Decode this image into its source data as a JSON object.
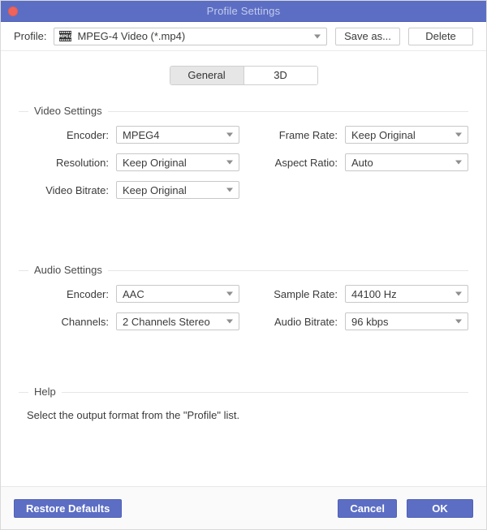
{
  "titlebar": {
    "title": "Profile Settings",
    "close_label": "close",
    "bg_color": "#5c6ec4",
    "close_color": "#f1635a"
  },
  "profile_row": {
    "label": "Profile:",
    "icon": "mpeg-film-icon",
    "value": "MPEG-4 Video (*.mp4)",
    "save_as_label": "Save as...",
    "delete_label": "Delete"
  },
  "tabs": [
    {
      "label": "General",
      "active": true
    },
    {
      "label": "3D",
      "active": false
    }
  ],
  "video_settings": {
    "title": "Video Settings",
    "fields": [
      {
        "label": "Encoder:",
        "value": "MPEG4"
      },
      {
        "label": "Frame Rate:",
        "value": "Keep Original"
      },
      {
        "label": "Resolution:",
        "value": "Keep Original"
      },
      {
        "label": "Aspect Ratio:",
        "value": "Auto"
      },
      {
        "label": "Video Bitrate:",
        "value": "Keep Original"
      }
    ]
  },
  "audio_settings": {
    "title": "Audio Settings",
    "fields": [
      {
        "label": "Encoder:",
        "value": "AAC"
      },
      {
        "label": "Sample Rate:",
        "value": "44100 Hz"
      },
      {
        "label": "Channels:",
        "value": "2 Channels Stereo"
      },
      {
        "label": "Audio Bitrate:",
        "value": "96 kbps"
      }
    ]
  },
  "help": {
    "title": "Help",
    "text": "Select the output format from the \"Profile\" list."
  },
  "footer": {
    "restore_label": "Restore Defaults",
    "cancel_label": "Cancel",
    "ok_label": "OK",
    "button_color": "#5c6ec4"
  }
}
